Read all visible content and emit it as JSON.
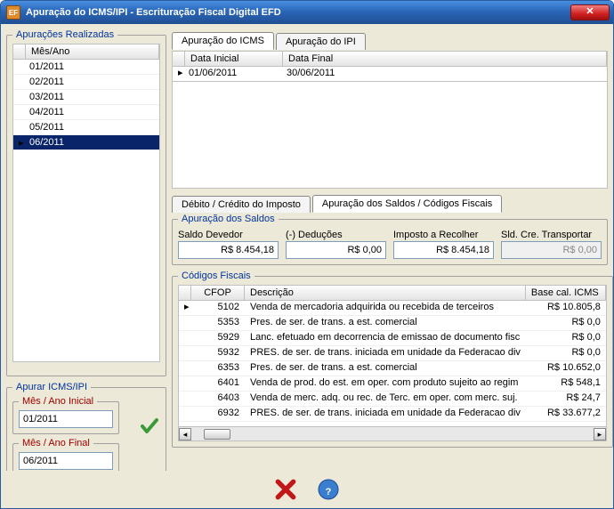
{
  "window": {
    "title": "Apuração do ICMS/IPI - Escrituração Fiscal Digital  EFD",
    "app_code": "EF"
  },
  "left": {
    "group_title": "Apurações Realizadas",
    "col_header": "Mês/Ano",
    "rows": [
      "01/2011",
      "02/2011",
      "03/2011",
      "04/2011",
      "05/2011",
      "06/2011"
    ],
    "selected_index": 5
  },
  "apurar": {
    "group_title": "Apurar ICMS/IPI",
    "mes_inicial_label": "Mês /  Ano Inicial",
    "mes_inicial_value": "01/2011",
    "mes_final_label": "Mês /  Ano Final",
    "mes_final_value": "06/2011"
  },
  "tabs": {
    "icms": "Apuração do ICMS",
    "ipi": "Apuração do IPI",
    "active": "icms"
  },
  "date_grid": {
    "col1": "Data Inicial",
    "col2": "Data Final",
    "v1": "01/06/2011",
    "v2": "30/06/2011"
  },
  "subtabs": {
    "debito": "Débito / Crédito do Imposto",
    "saldos": "Apuração dos Saldos / Códigos Fiscais",
    "active": "saldos"
  },
  "saldos": {
    "group_title": "Apuração dos Saldos",
    "devedor_label": "Saldo Devedor",
    "devedor_value": "R$ 8.454,18",
    "deducoes_label": "(-) Deduções",
    "deducoes_value": "R$ 0,00",
    "recolher_label": "Imposto a Recolher",
    "recolher_value": "R$ 8.454,18",
    "transportar_label": "Sld. Cre. Transportar",
    "transportar_value": "R$ 0,00"
  },
  "cfop": {
    "group_title": "Códigos Fiscais",
    "col_cfop": "CFOP",
    "col_desc": "Descrição",
    "col_base": "Base cal. ICMS",
    "rows": [
      {
        "cfop": "5102",
        "desc": "Venda de mercadoria adquirida ou recebida de terceiros",
        "base": "R$ 10.805,8"
      },
      {
        "cfop": "5353",
        "desc": "Pres. de ser. de trans. a est. comercial",
        "base": "R$ 0,0"
      },
      {
        "cfop": "5929",
        "desc": "Lanc. efetuado em decorrencia de emissao de documento fisc",
        "base": "R$ 0,0"
      },
      {
        "cfop": "5932",
        "desc": "PRES. de ser. de trans. iniciada em unidade da Federacao div",
        "base": "R$ 0,0"
      },
      {
        "cfop": "6353",
        "desc": "Pres. de ser. de trans. a est. comercial",
        "base": "R$ 10.652,0"
      },
      {
        "cfop": "6401",
        "desc": "Venda de prod. do est. em oper. com produto sujeito ao regim",
        "base": "R$ 548,1"
      },
      {
        "cfop": "6403",
        "desc": "Venda de merc. adq. ou rec. de Terc. em oper. com merc. suj.",
        "base": "R$ 24,7"
      },
      {
        "cfop": "6932",
        "desc": "PRES. de ser. de trans. iniciada em unidade da Federacao div",
        "base": "R$ 33.677,2"
      }
    ]
  }
}
